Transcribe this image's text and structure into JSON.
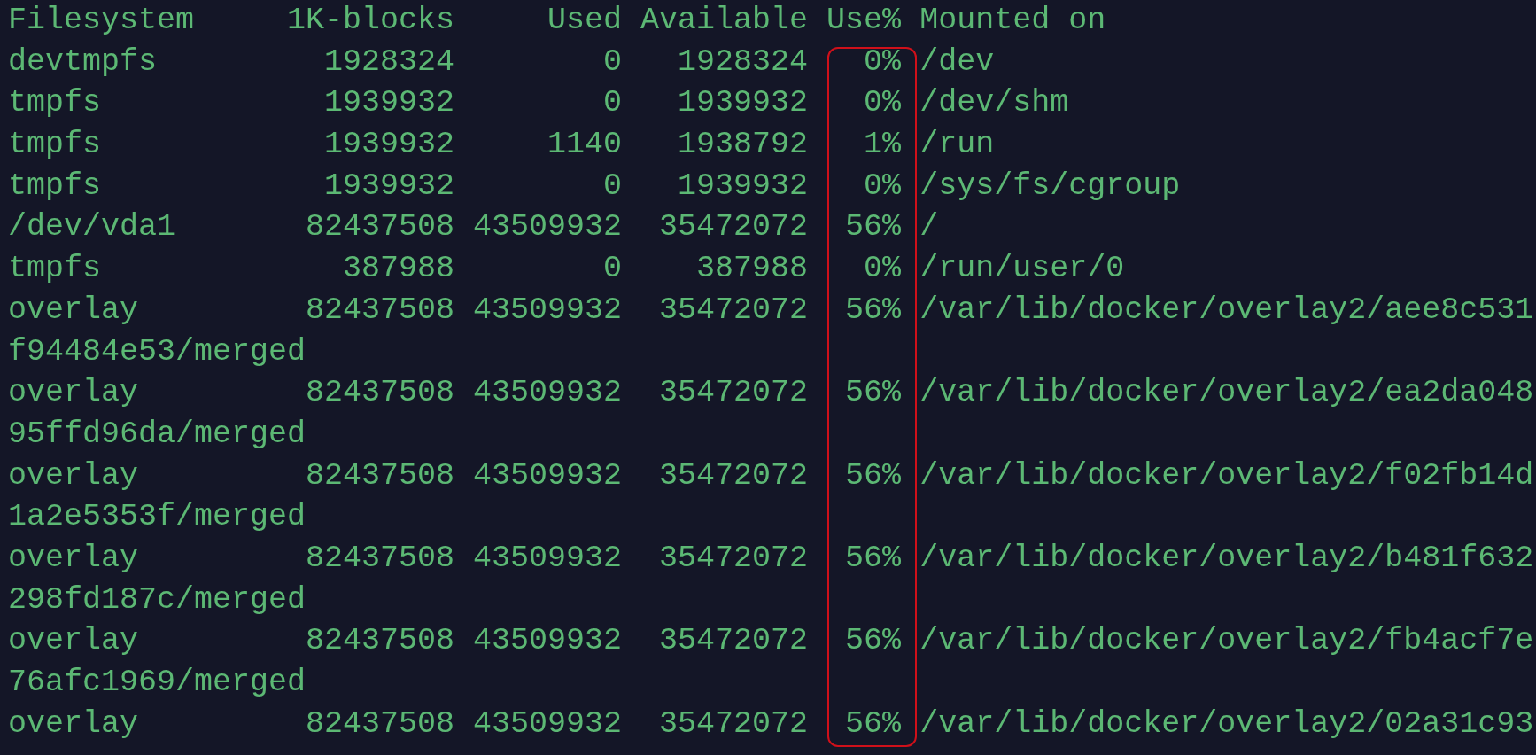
{
  "columns": [
    "Filesystem",
    "1K-blocks",
    "Used",
    "Available",
    "Use%",
    "Mounted on"
  ],
  "rows": [
    {
      "cells": [
        "devtmpfs",
        "1928324",
        "0",
        "1928324",
        "0%",
        "/dev"
      ]
    },
    {
      "cells": [
        "tmpfs",
        "1939932",
        "0",
        "1939932",
        "0%",
        "/dev/shm"
      ]
    },
    {
      "cells": [
        "tmpfs",
        "1939932",
        "1140",
        "1938792",
        "1%",
        "/run"
      ]
    },
    {
      "cells": [
        "tmpfs",
        "1939932",
        "0",
        "1939932",
        "0%",
        "/sys/fs/cgroup"
      ]
    },
    {
      "cells": [
        "/dev/vda1",
        "82437508",
        "43509932",
        "35472072",
        "56%",
        "/"
      ]
    },
    {
      "cells": [
        "tmpfs",
        "387988",
        "0",
        "387988",
        "0%",
        "/run/user/0"
      ]
    },
    {
      "cells": [
        "overlay",
        "82437508",
        "43509932",
        "35472072",
        "56%",
        "/var/lib/docker/overlay2/aee8c531"
      ],
      "wrapped": "f94484e53/merged"
    },
    {
      "cells": [
        "overlay",
        "82437508",
        "43509932",
        "35472072",
        "56%",
        "/var/lib/docker/overlay2/ea2da048"
      ],
      "wrapped": "95ffd96da/merged"
    },
    {
      "cells": [
        "overlay",
        "82437508",
        "43509932",
        "35472072",
        "56%",
        "/var/lib/docker/overlay2/f02fb14d"
      ],
      "wrapped": "1a2e5353f/merged"
    },
    {
      "cells": [
        "overlay",
        "82437508",
        "43509932",
        "35472072",
        "56%",
        "/var/lib/docker/overlay2/b481f632"
      ],
      "wrapped": "298fd187c/merged"
    },
    {
      "cells": [
        "overlay",
        "82437508",
        "43509932",
        "35472072",
        "56%",
        "/var/lib/docker/overlay2/fb4acf7e"
      ],
      "wrapped": "76afc1969/merged"
    },
    {
      "cells": [
        "overlay",
        "82437508",
        "43509932",
        "35472072",
        "56%",
        "/var/lib/docker/overlay2/02a31c93"
      ]
    }
  ]
}
